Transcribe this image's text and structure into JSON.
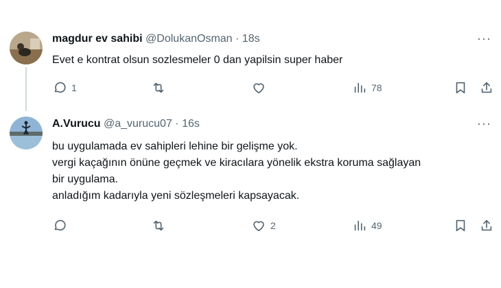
{
  "tweets": [
    {
      "display_name": "magdur ev sahibi",
      "handle": "@DolukanOsman",
      "separator": "·",
      "time": "18s",
      "more": "···",
      "lines": [
        "Evet e kontrat olsun sozlesmeler 0 dan yapilsin super haber"
      ],
      "replies": "1",
      "retweets": "",
      "likes": "",
      "views": "78"
    },
    {
      "display_name": "A.Vurucu",
      "handle": "@a_vurucu07",
      "separator": "·",
      "time": "16s",
      "more": "···",
      "lines": [
        "bu uygulamada ev sahipleri lehine bir gelişme yok.",
        "vergi kaçağının önüne geçmek ve kiracılara yönelik ekstra koruma sağlayan",
        "bir uygulama.",
        "anladığım kadarıyla yeni sözleşmeleri kapsayacak."
      ],
      "replies": "",
      "retweets": "",
      "likes": "2",
      "views": "49"
    }
  ]
}
